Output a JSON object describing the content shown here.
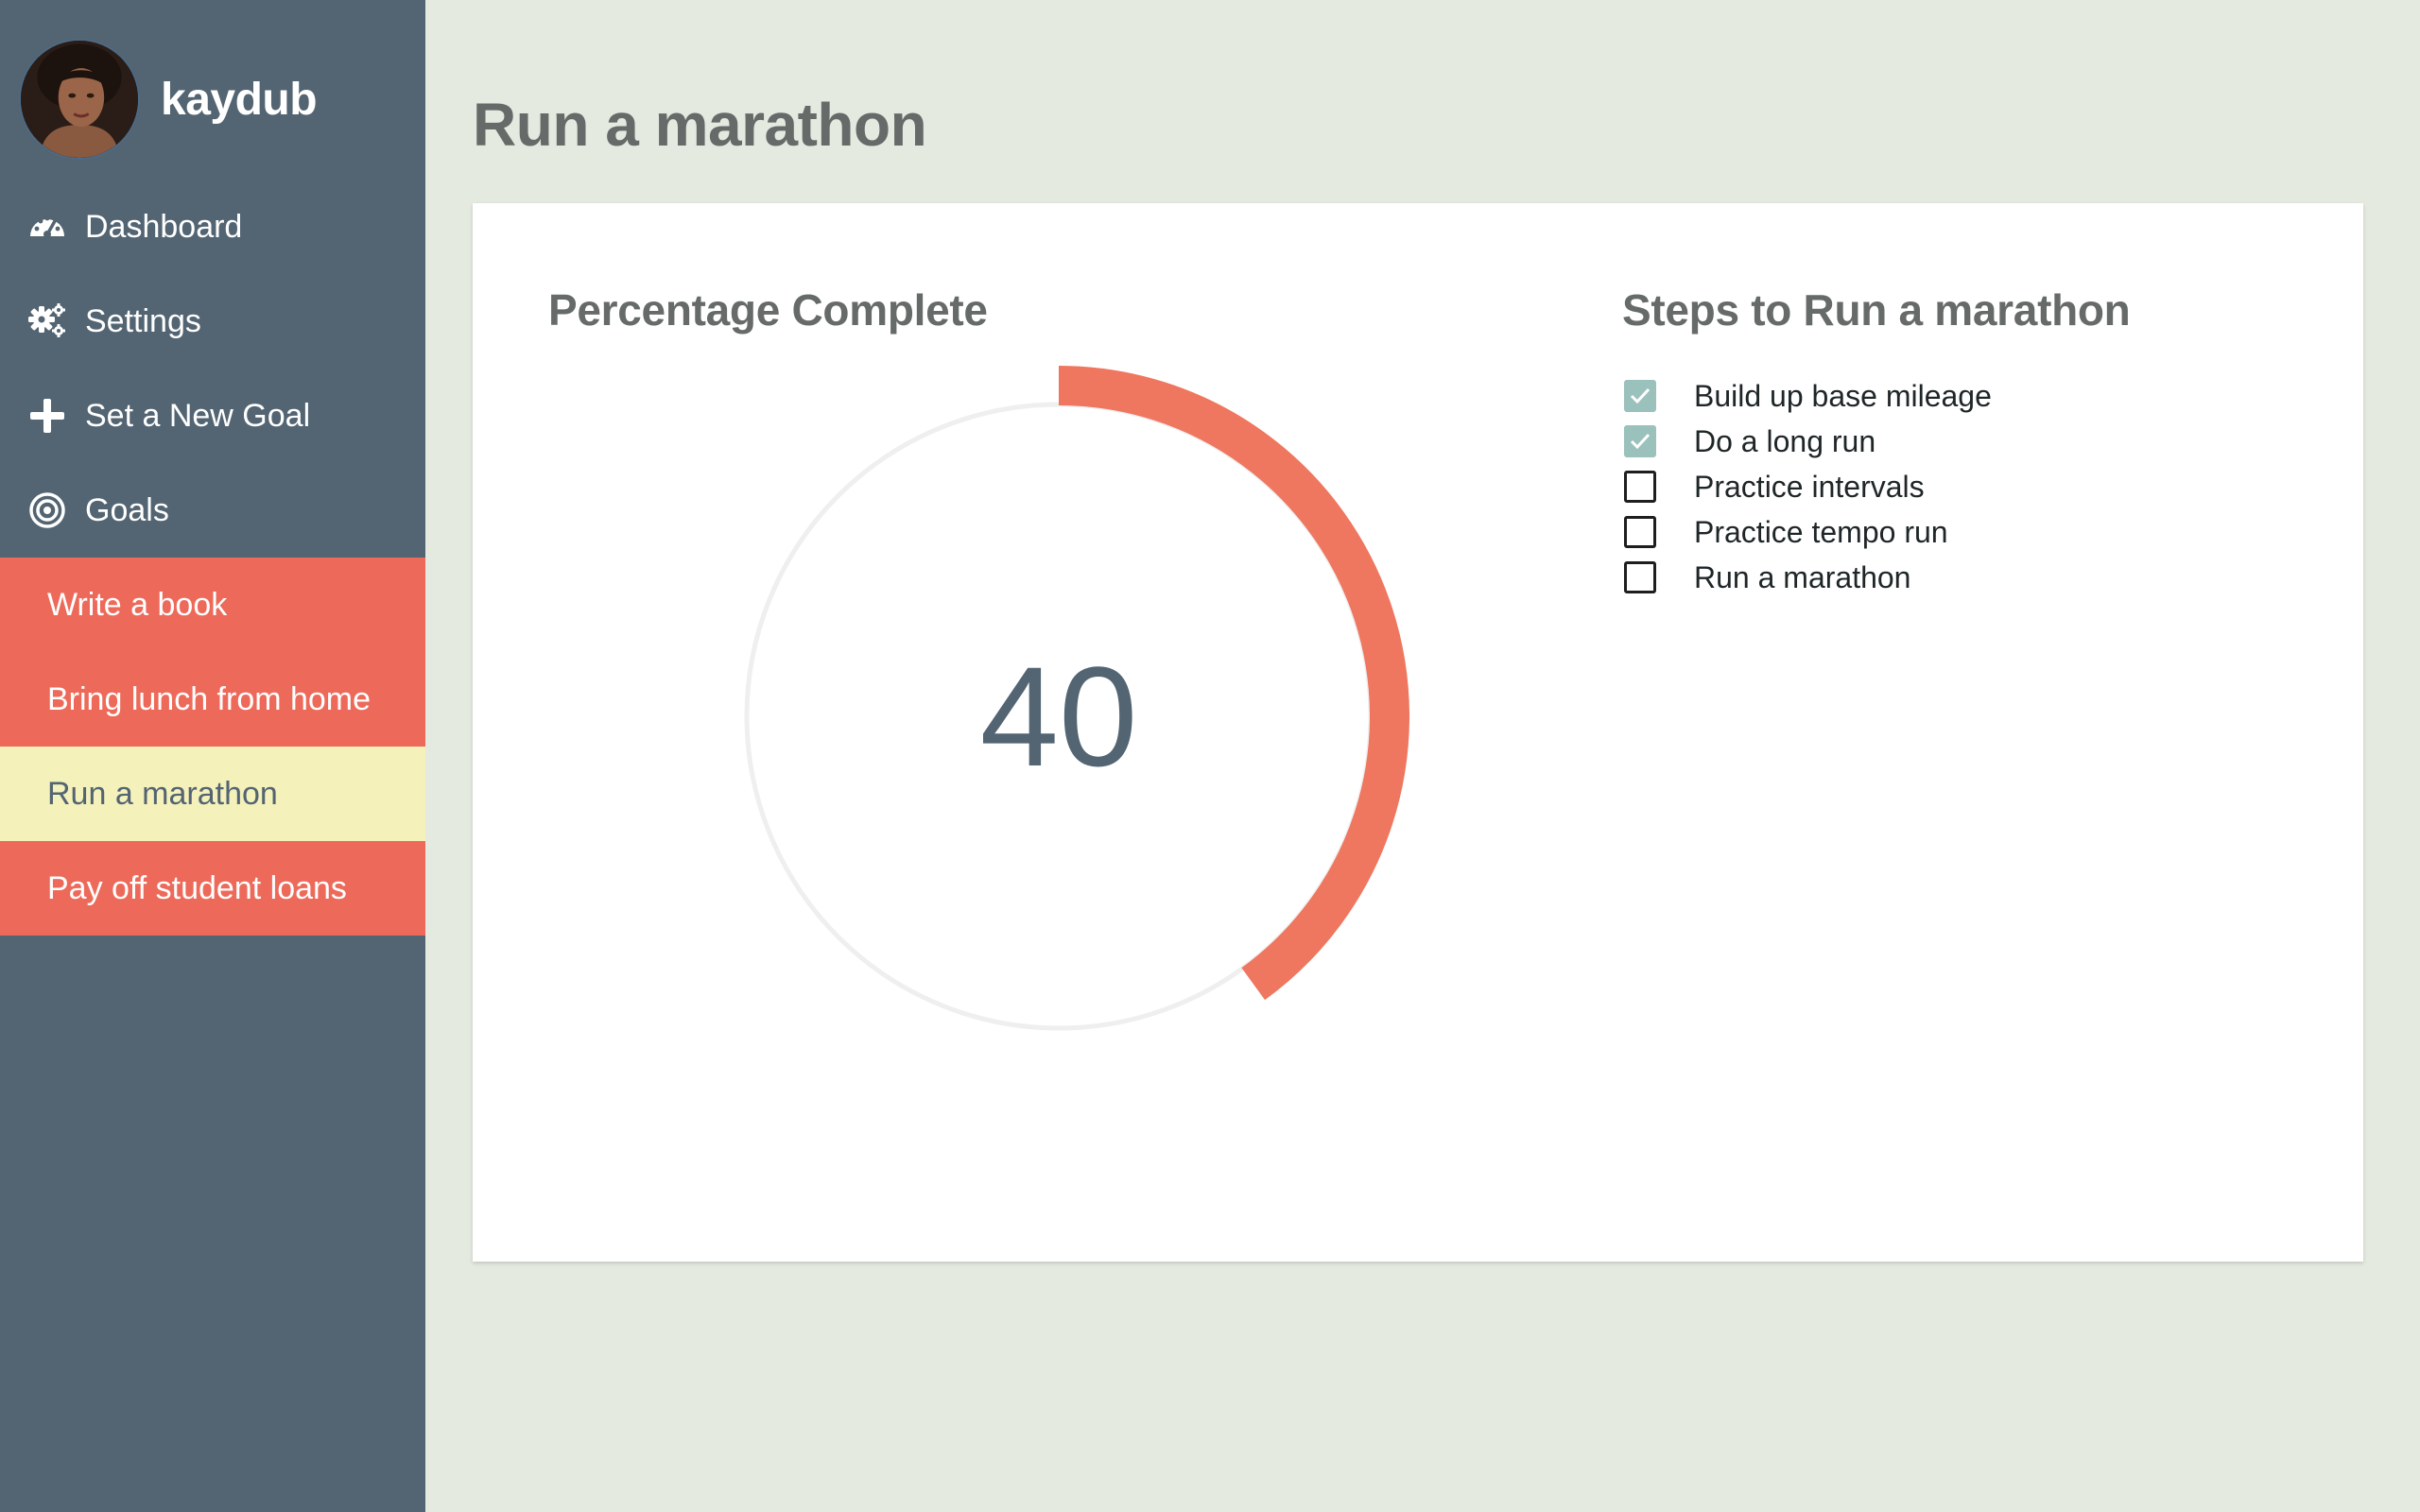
{
  "user": {
    "username": "kaydub"
  },
  "nav": [
    {
      "label": "Dashboard",
      "icon": "dashboard-icon"
    },
    {
      "label": "Settings",
      "icon": "gear-icon"
    },
    {
      "label": "Set a New Goal",
      "icon": "plus-icon"
    },
    {
      "label": "Goals",
      "icon": "target-icon"
    }
  ],
  "goals": [
    {
      "label": "Write a book",
      "active": false
    },
    {
      "label": "Bring lunch from home",
      "active": false
    },
    {
      "label": "Run a marathon",
      "active": true
    },
    {
      "label": "Pay off student loans",
      "active": false
    }
  ],
  "page": {
    "title": "Run a marathon"
  },
  "progress": {
    "heading": "Percentage Complete",
    "value": 40,
    "display": "40"
  },
  "steps": {
    "heading": "Steps to Run a marathon",
    "items": [
      {
        "label": "Build up base mileage",
        "checked": true
      },
      {
        "label": "Do a long run",
        "checked": true
      },
      {
        "label": "Practice intervals",
        "checked": false
      },
      {
        "label": "Practice tempo run",
        "checked": false
      },
      {
        "label": "Run a marathon",
        "checked": false
      }
    ]
  },
  "colors": {
    "sidebar": "#536472",
    "goal": "#ed6a5a",
    "goal_active": "#f4f1bb",
    "background": "#e4eae0",
    "progress_arc": "#ef765f",
    "progress_track": "#efefef",
    "checkbox_checked": "#9bc1bc"
  }
}
